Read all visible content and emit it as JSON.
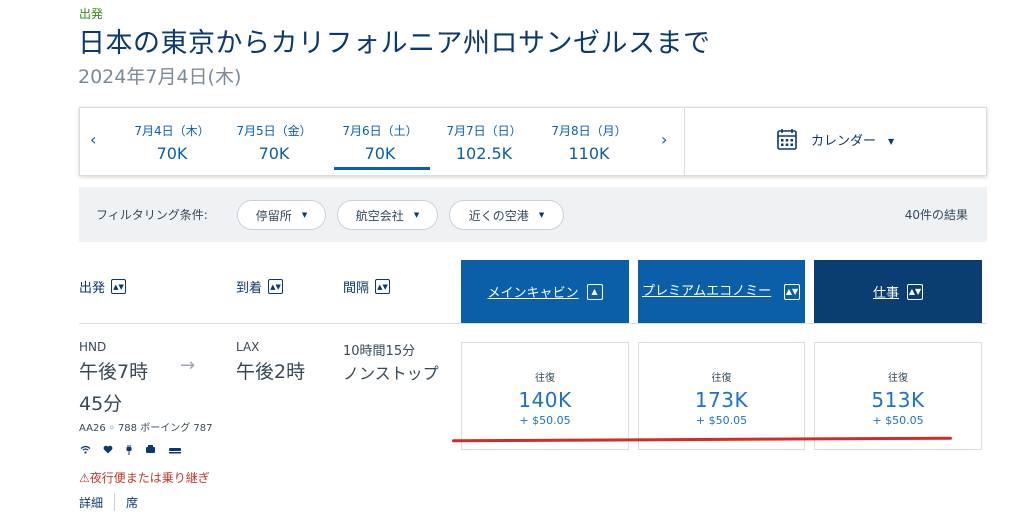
{
  "header": {
    "eyebrow": "出発",
    "title": "日本の東京からカリフォルニア州ロサンゼルスまで",
    "date": "2024年7月4日(木)"
  },
  "date_strip": {
    "prev": "‹",
    "next": "›",
    "dates": [
      {
        "date": "7月4日（木）",
        "price": "70K"
      },
      {
        "date": "7月5日（金）",
        "price": "70K"
      },
      {
        "date": "7月6日（土）",
        "price": "70K",
        "selected": true
      },
      {
        "date": "7月7日（日）",
        "price": "102.5K"
      },
      {
        "date": "7月8日（月）",
        "price": "110K"
      }
    ],
    "calendar_label": "カレンダー"
  },
  "filters": {
    "label": "フィルタリング条件:",
    "chips": [
      "停留所",
      "航空会社",
      "近くの空港"
    ],
    "result_count": "40件の結果"
  },
  "columns": {
    "depart": "出発",
    "arrive": "到着",
    "duration": "間隔",
    "cabins": [
      "メインキャビン",
      "プレミアムエコノミー",
      "仕事"
    ]
  },
  "flight": {
    "origin_code": "HND",
    "depart_time": "午後7時",
    "depart_time_2": "45分",
    "dest_code": "LAX",
    "arrive_time": "午後2時",
    "duration": "10時間15分",
    "stops": "ノンストップ",
    "aircraft": "AA26 ◦ 788 ボーイング 787",
    "warning": "⚠夜行便または乗り継ぎ",
    "details_link": "詳細",
    "seats_link": "席",
    "fares": [
      {
        "trip": "往復",
        "points": "140K",
        "tax": "+ $50.05"
      },
      {
        "trip": "往復",
        "points": "173K",
        "tax": "+ $50.05"
      },
      {
        "trip": "往復",
        "points": "513K",
        "tax": "+ $50.05"
      }
    ]
  },
  "colors": {
    "brand_dark": "#0b3a6b",
    "brand_blue": "#0b5fa8",
    "fare_blue": "#1a73c7",
    "warning_red": "#c0392b"
  }
}
